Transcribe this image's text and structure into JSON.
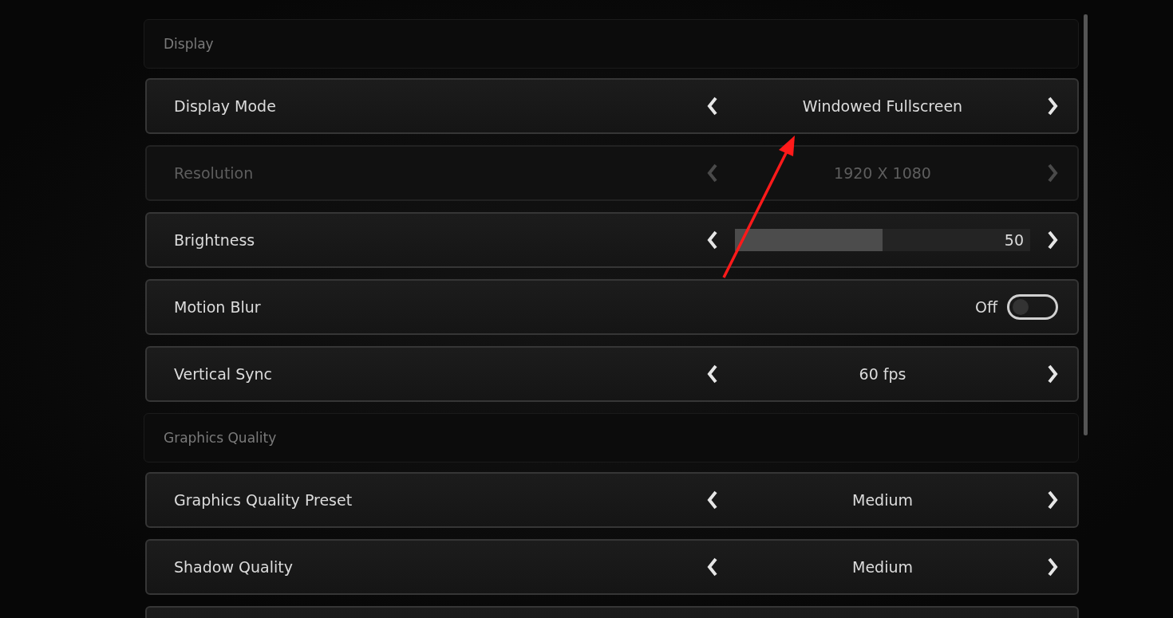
{
  "sections": [
    {
      "title": "Display",
      "rows": [
        {
          "kind": "select",
          "label": "Display Mode",
          "value": "Windowed Fullscreen",
          "disabled": false
        },
        {
          "kind": "select",
          "label": "Resolution",
          "value": "1920 X 1080",
          "disabled": true
        },
        {
          "kind": "slider",
          "label": "Brightness",
          "level": 0.5,
          "reading": "50",
          "disabled": false
        },
        {
          "kind": "toggle",
          "label": "Motion Blur",
          "on": false,
          "reading": "Off",
          "disabled": false
        },
        {
          "kind": "select",
          "label": "Vertical Sync",
          "value": "60 fps",
          "disabled": false
        }
      ]
    },
    {
      "title": "Graphics Quality",
      "rows": [
        {
          "kind": "select",
          "label": "Graphics Quality Preset",
          "value": "Medium",
          "disabled": false
        },
        {
          "kind": "select",
          "label": "Shadow Quality",
          "value": "Medium",
          "disabled": false
        }
      ]
    }
  ]
}
